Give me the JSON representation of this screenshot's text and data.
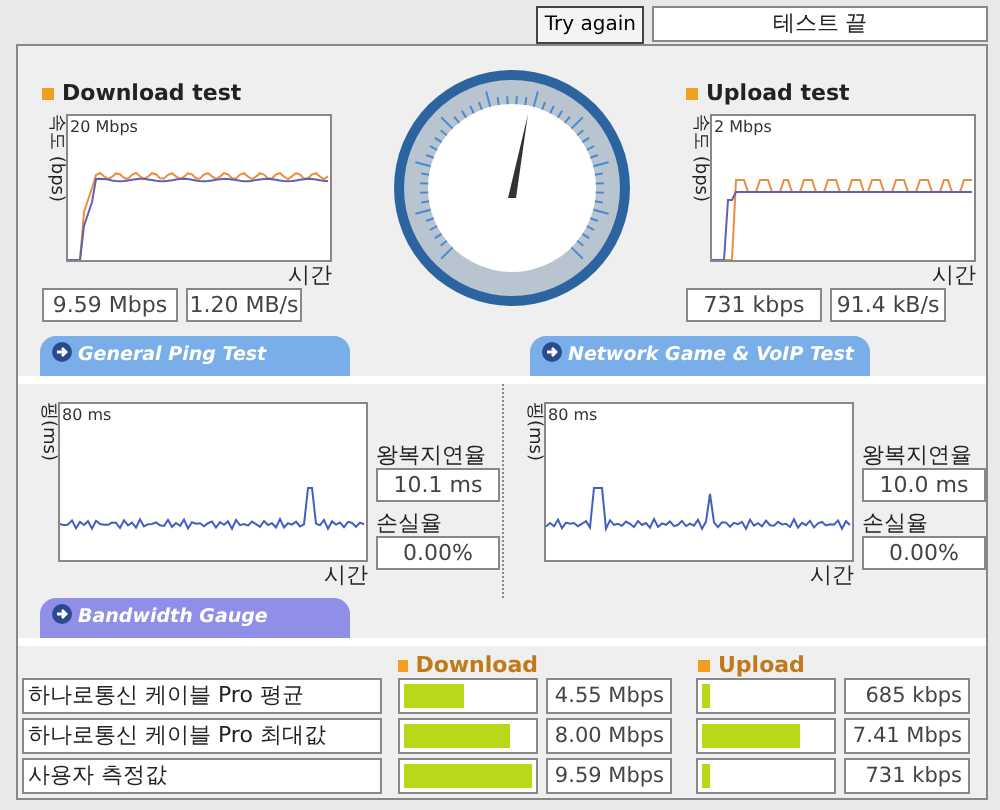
{
  "toolbar": {
    "retry_button": "Try again",
    "status": "테스트 끝"
  },
  "speed_tests": [
    {
      "title": "Download test",
      "axis_label": "속도 (bps)",
      "scale": "20 Mbps",
      "time_label": "시간",
      "readings": [
        "9.59 Mbps",
        "1.20 MB/s"
      ]
    },
    {
      "title": "Upload test",
      "axis_label": "속도 (bps)",
      "scale": "2 Mbps",
      "time_label": "시간",
      "readings": [
        "731 kbps",
        "91.4 kB/s"
      ]
    }
  ],
  "ping_tabs": [
    {
      "label": "General Ping Test"
    },
    {
      "label": "Network Game & VoIP Test"
    }
  ],
  "ping_tests": [
    {
      "axis_label": "핑(ms)",
      "scale": "80 ms",
      "time_label": "시간",
      "latency_label": "왕복지연율",
      "latency": "10.1 ms",
      "loss_label": "손실율",
      "loss": "0.00%"
    },
    {
      "axis_label": "핑(ms)",
      "scale": "80 ms",
      "time_label": "시간",
      "latency_label": "왕복지연율",
      "latency": "10.0 ms",
      "loss_label": "손실율",
      "loss": "0.00%"
    }
  ],
  "bandwidth_tab": "Bandwidth Gauge",
  "bandwidth": {
    "columns": [
      "Download",
      "Upload"
    ],
    "rows": [
      {
        "label": "하나로통신 케이블 Pro 평균",
        "download": {
          "level": 0.47,
          "value": "4.55 Mbps"
        },
        "upload": {
          "level": 0.06,
          "value": "685 kbps"
        }
      },
      {
        "label": "하나로통신 케이블 Pro 최대값",
        "download": {
          "level": 0.83,
          "value": "8.00 Mbps"
        },
        "upload": {
          "level": 0.76,
          "value": "7.41 Mbps"
        }
      },
      {
        "label": "사용자 측정값",
        "download": {
          "level": 1.0,
          "value": "9.59 Mbps"
        },
        "upload": {
          "level": 0.06,
          "value": "731 kbps"
        }
      }
    ]
  }
}
